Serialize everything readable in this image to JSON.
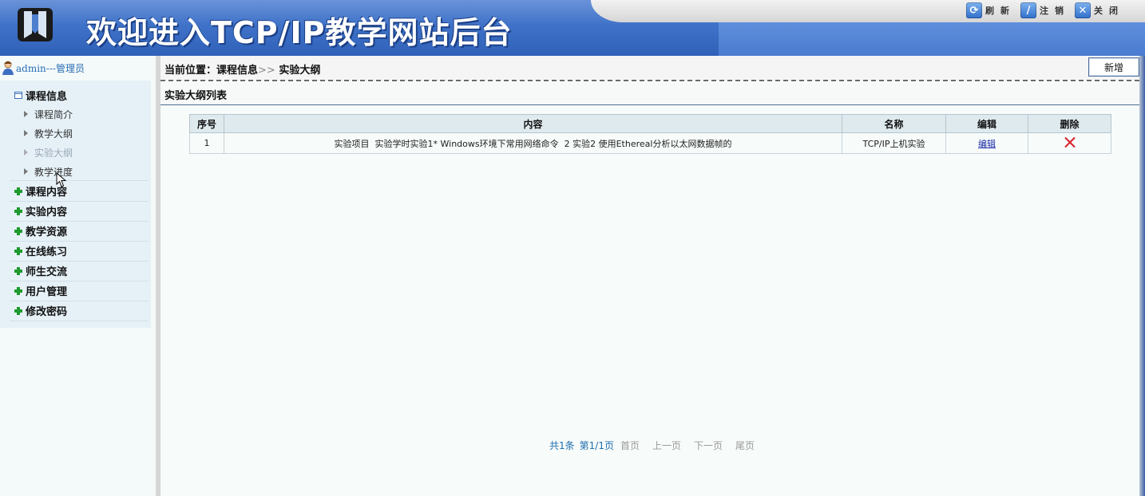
{
  "header": {
    "title": "欢迎进入TCP/IP教学网站后台",
    "actions": [
      {
        "icon": "refresh-icon",
        "label": "刷新"
      },
      {
        "icon": "logout-icon",
        "label": "注销"
      },
      {
        "icon": "close-icon",
        "label": "关闭"
      }
    ]
  },
  "sidebar": {
    "user_label": "admin---管理员",
    "groups": [
      {
        "label": "课程信息",
        "expanded": true,
        "items": [
          "课程简介",
          "教学大纲",
          "实验大纲",
          "教学进度"
        ],
        "active_item": "实验大纲"
      },
      {
        "label": "课程内容",
        "expanded": false
      },
      {
        "label": "实验内容",
        "expanded": false
      },
      {
        "label": "教学资源",
        "expanded": false
      },
      {
        "label": "在线练习",
        "expanded": false
      },
      {
        "label": "师生交流",
        "expanded": false
      },
      {
        "label": "用户管理",
        "expanded": false
      },
      {
        "label": "修改密码",
        "expanded": false
      }
    ]
  },
  "breadcrumb": {
    "prefix": "当前位置：",
    "section": "课程信息",
    "separator": ">>",
    "current": "实验大纲"
  },
  "add_button_label": "新增",
  "list_title": "实验大纲列表",
  "table": {
    "columns": [
      "序号",
      "内容",
      "名称",
      "编辑",
      "删除"
    ],
    "rows": [
      {
        "index": "1",
        "content": "实验项目  实验学时实验1* Windows环境下常用网络命令  2 实验2 使用Ethereal分析以太网数据帧的",
        "name": "TCP/IP上机实验",
        "edit_label": "编辑",
        "delete_icon": "delete-x-icon"
      }
    ]
  },
  "pager": {
    "total": "共1条",
    "page": "第1/1页",
    "first": "首页",
    "prev": "上一页",
    "next": "下一页",
    "last": "尾页"
  },
  "colors": {
    "header_blue": "#3f72c8",
    "link_blue": "#1d2ea8",
    "menu_plus_green": "#1e9a2e",
    "delete_red": "#d8202a",
    "pager_info": "#1f6fae"
  }
}
